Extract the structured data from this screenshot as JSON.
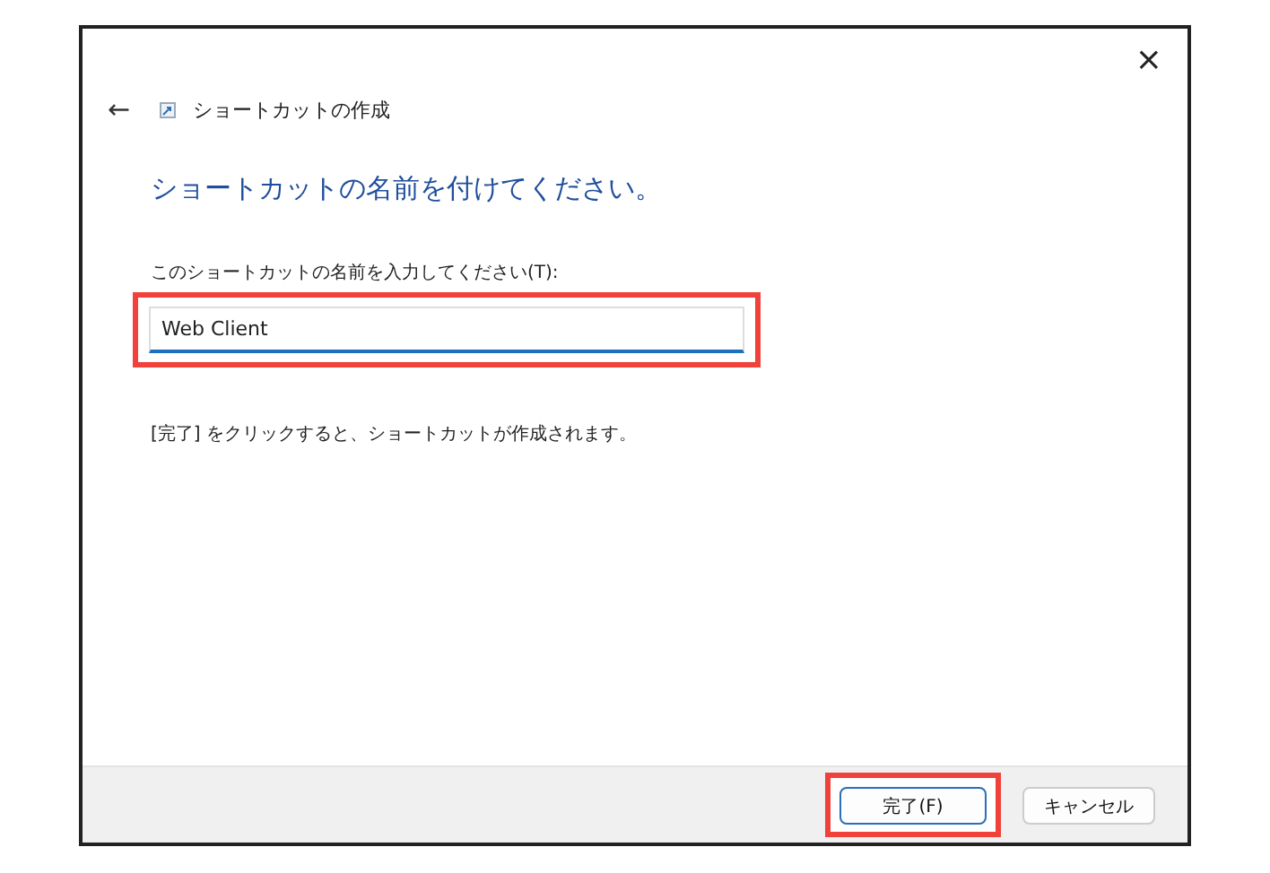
{
  "window": {
    "title": "ショートカットの作成",
    "close": "×",
    "back": "←"
  },
  "heading": "ショートカットの名前を付けてください。",
  "name_field": {
    "label": "このショートカットの名前を入力してください(T):",
    "value": "Web Client",
    "highlighted": true
  },
  "hint": "[完了] をクリックすると、ショートカットが作成されます。",
  "buttons": [
    {
      "label": "完了(F)",
      "default": true,
      "highlighted": true
    },
    {
      "label": "キャンセル",
      "default": false,
      "highlighted": false
    }
  ]
}
